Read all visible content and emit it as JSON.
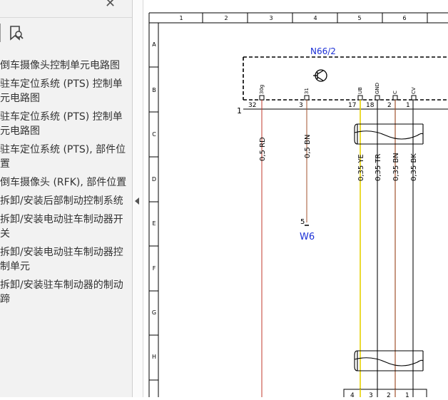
{
  "sidebar": {
    "close_glyph": "✕",
    "bookmark_icon": "bookmark-search-icon",
    "items": [
      {
        "label": "倒车摄像头控制单元电路图"
      },
      {
        "label": "驻车定位系统 (PTS) 控制单元电路图"
      },
      {
        "label": "驻车定位系统 (PTS) 控制单元电路图"
      },
      {
        "label": "驻车定位系统 (PTS), 部件位置"
      },
      {
        "label": "倒车摄像头 (RFK), 部件位置"
      },
      {
        "label": "拆卸/安装后部制动控制系统"
      },
      {
        "label": "拆卸/安装电动驻车制动器开关"
      },
      {
        "label": "拆卸/安装电动驻车制动器控制单元"
      },
      {
        "label": "拆卸/安装驻车制动器的制动蹄"
      }
    ]
  },
  "diagram": {
    "columns": [
      "1",
      "2",
      "3",
      "4",
      "5",
      "6"
    ],
    "rows": [
      "A",
      "B",
      "C",
      "D",
      "E",
      "F",
      "G",
      "H"
    ],
    "component": "N66/2",
    "pin_labels": [
      "30g",
      "31",
      "UB",
      "GND",
      "C",
      "CV"
    ],
    "pins": [
      "32",
      "3",
      "17",
      "18",
      "2",
      "1"
    ],
    "left_marker": "1",
    "wires": [
      "0,5 RD",
      "0,5 BN",
      "0,35 YE",
      "0,35 TR",
      "0,35 BN",
      "0,35 BK"
    ],
    "connector_pin": "5",
    "connector": "W6",
    "bottom_pins": [
      "4",
      "3",
      "2",
      "1"
    ],
    "colors": {
      "rd": "#c0392b",
      "bn": "#a0522d",
      "ye": "#e6d200",
      "tr": "#222222",
      "bk": "#222222",
      "blue": "#1a2fd6"
    }
  }
}
